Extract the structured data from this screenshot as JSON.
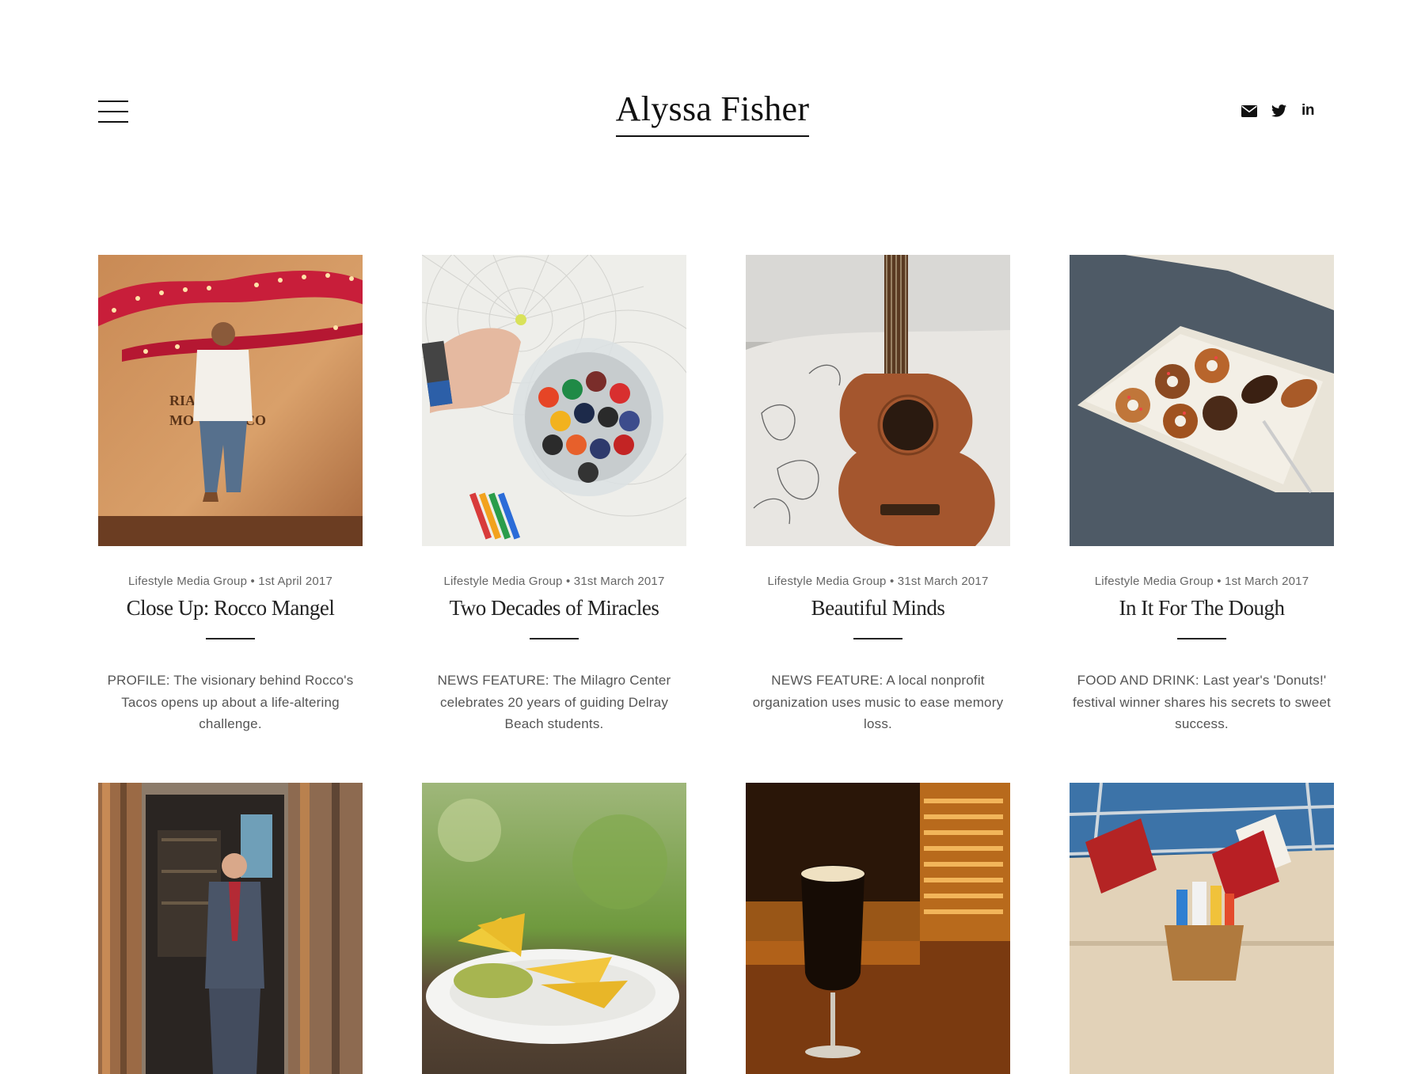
{
  "site": {
    "title": "Alyssa Fisher"
  },
  "menu": {
    "icon": "hamburger-menu-icon"
  },
  "social": [
    {
      "name": "email",
      "icon": "envelope-icon"
    },
    {
      "name": "twitter",
      "icon": "twitter-icon"
    },
    {
      "name": "linkedin",
      "icon": "linkedin-icon",
      "glyph": "in"
    }
  ],
  "articles": [
    {
      "publisher": "Lifestyle Media Group",
      "date": "1st April 2017",
      "title": "Close Up: Rocco Mangel",
      "excerpt": "PROFILE: The visionary behind Rocco's Tacos opens up about a life-altering challenge."
    },
    {
      "publisher": "Lifestyle Media Group",
      "date": "31st March 2017",
      "title": "Two Decades of Miracles",
      "excerpt": "NEWS FEATURE: The Milagro Center celebrates 20 years of guiding Delray Beach students."
    },
    {
      "publisher": "Lifestyle Media Group",
      "date": "31st March 2017",
      "title": "Beautiful Minds",
      "excerpt": "NEWS FEATURE: A local nonprofit organization uses music to ease memory loss."
    },
    {
      "publisher": "Lifestyle Media Group",
      "date": "1st March 2017",
      "title": "In It For The Dough",
      "excerpt": "FOOD AND DRINK: Last year's 'Donuts!' festival winner shares his secrets to sweet success."
    }
  ],
  "colors": {
    "text": "#222222",
    "meta": "#666666",
    "excerpt": "#555555",
    "background": "#ffffff"
  }
}
